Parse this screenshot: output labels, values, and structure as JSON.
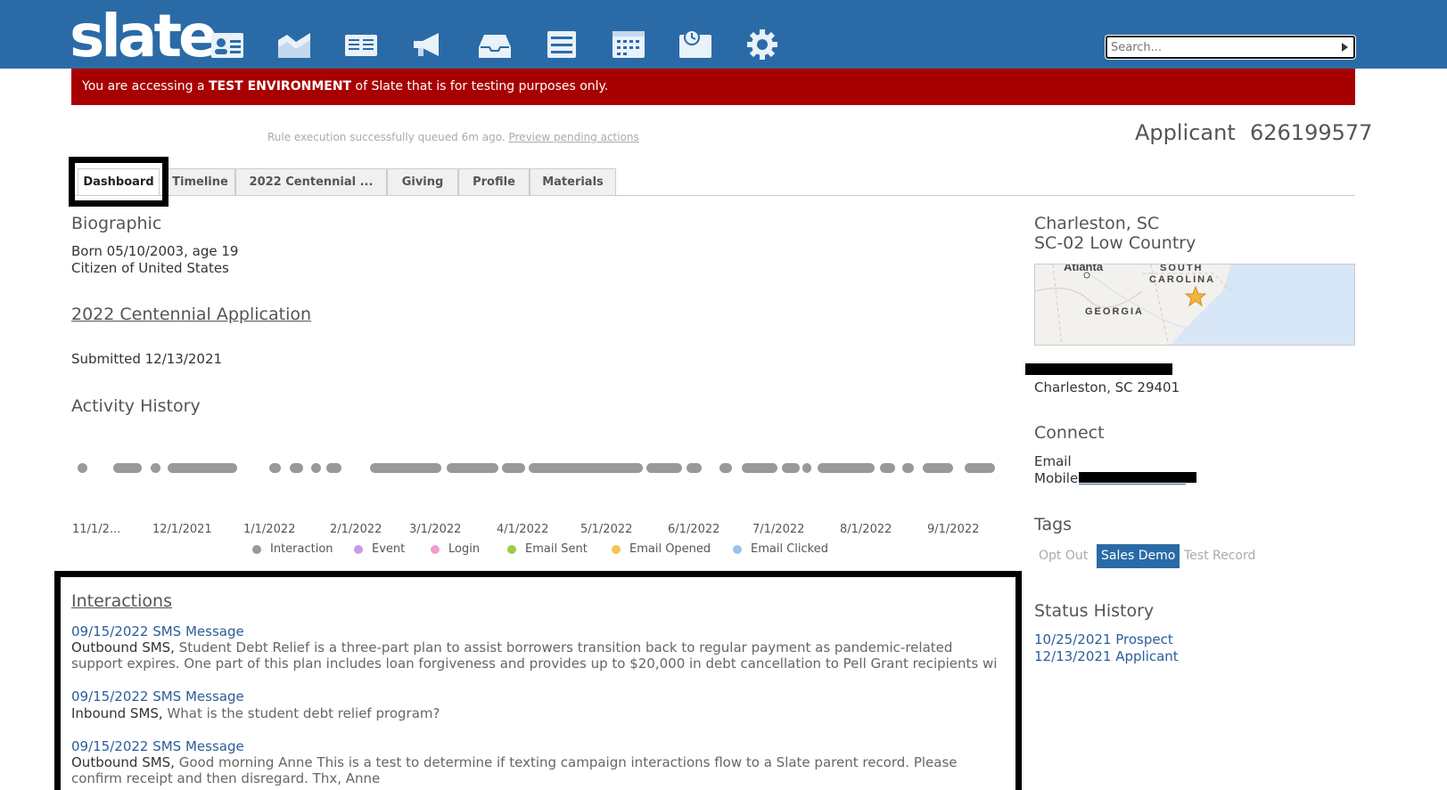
{
  "app": {
    "logo": "slate",
    "nav_icons": [
      "contact-card-icon",
      "chart-icon",
      "reader-icon",
      "megaphone-icon",
      "inbox-icon",
      "list-icon",
      "calendar-icon",
      "clock-icon",
      "gear-icon"
    ],
    "search_placeholder": "Search...",
    "colors": {
      "header": "#2a6ba7",
      "banner": "#a80000",
      "link": "#2a5e98"
    }
  },
  "banner": {
    "prefix": "You are accessing a ",
    "emphasis": "TEST ENVIRONMENT",
    "suffix": " of Slate that is for testing purposes only."
  },
  "rule_status": {
    "message": "Rule execution successfully queued 6m ago. ",
    "link": "Preview pending actions"
  },
  "record": {
    "type": "Applicant",
    "id": "626199577"
  },
  "tabs": [
    {
      "label": "Dashboard",
      "active": true
    },
    {
      "label": "Timeline",
      "active": false
    },
    {
      "label": "2022 Centennial ...",
      "active": false
    },
    {
      "label": "Giving",
      "active": false
    },
    {
      "label": "Profile",
      "active": false
    },
    {
      "label": "Materials",
      "active": false
    }
  ],
  "biographic": {
    "heading": "Biographic",
    "born": "Born 05/10/2003, age 19",
    "citizen": "Citizen of United States"
  },
  "application": {
    "title": "2022 Centennial Application",
    "submitted": "Submitted 12/13/2021"
  },
  "activity": {
    "heading": "Activity History",
    "ticks": [
      "11/1/2...",
      "12/1/2021",
      "1/1/2022",
      "2/1/2022",
      "3/1/2022",
      "4/1/2022",
      "5/1/2022",
      "6/1/2022",
      "7/1/2022",
      "8/1/2022",
      "9/1/2022"
    ],
    "legend": [
      {
        "label": "Interaction",
        "color": "#999999"
      },
      {
        "label": "Event",
        "color": "#c79be6"
      },
      {
        "label": "Login",
        "color": "#f29bd0"
      },
      {
        "label": "Email Sent",
        "color": "#9ccc45"
      },
      {
        "label": "Email Opened",
        "color": "#f5c451"
      },
      {
        "label": "Email Clicked",
        "color": "#99c3ec"
      }
    ]
  },
  "interactions": {
    "heading": "Interactions",
    "items": [
      {
        "date": "09/15/2022 SMS Message",
        "kind": "Outbound SMS,",
        "text": " Student Debt Relief is a three-part plan to assist borrowers transition back to regular payment as pandemic-related support expires. One part of this plan includes loan forgiveness and provides up to $20,000 in debt cancellation to Pell Grant recipients wi"
      },
      {
        "date": "09/15/2022 SMS Message",
        "kind": "Inbound SMS,",
        "text": " What is the student debt relief program?"
      },
      {
        "date": "09/15/2022 SMS Message",
        "kind": "Outbound SMS,",
        "text": " Good morning Anne     This is a test to determine if texting campaign interactions flow to a Slate parent record. Please confirm receipt and then disregard.   Thx, Anne"
      }
    ]
  },
  "location": {
    "city": "Charleston, SC",
    "district": "SC-02 Low Country",
    "map_labels": [
      "Atlanta",
      "SOUTH",
      "CAROLINA",
      "GEORGIA"
    ],
    "address_line2": "Charleston, SC 29401"
  },
  "connect": {
    "heading": "Connect",
    "email_label": "Email",
    "mobile_label": "Mobile"
  },
  "tags": {
    "heading": "Tags",
    "items": [
      {
        "label": "Opt Out",
        "active": false
      },
      {
        "label": "Sales Demo",
        "active": true
      },
      {
        "label": "Test Record",
        "active": false
      }
    ]
  },
  "status_history": {
    "heading": "Status History",
    "items": [
      "10/25/2021 Prospect",
      "12/13/2021 Applicant"
    ]
  }
}
